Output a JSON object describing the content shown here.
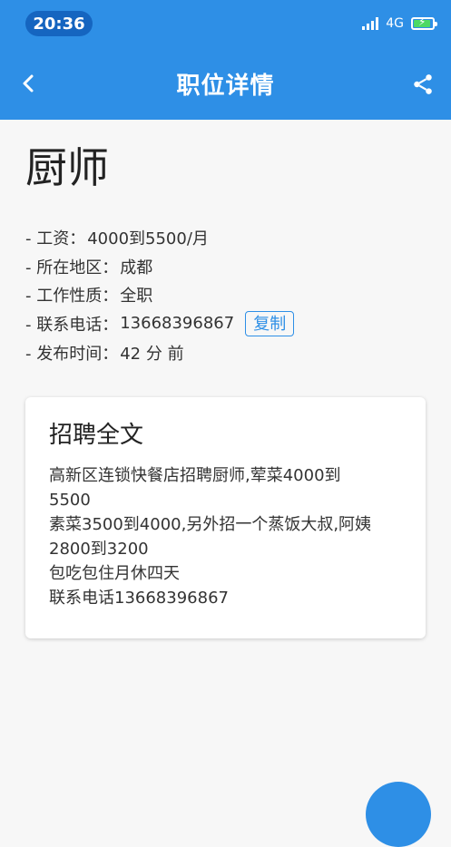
{
  "status": {
    "time": "20:36",
    "network": "4G"
  },
  "app_bar": {
    "title": "职位详情",
    "back_icon": "chevron-left-icon",
    "share_icon": "share-icon"
  },
  "job": {
    "title": "厨师",
    "details": [
      {
        "label": "- 工资：",
        "value": "4000到5500/月"
      },
      {
        "label": "- 所在地区：",
        "value": "成都"
      },
      {
        "label": "- 工作性质：",
        "value": "全职"
      },
      {
        "label": "- 联系电话：",
        "value": "13668396867"
      },
      {
        "label": "- 发布时间：",
        "value": "42 分 前"
      }
    ],
    "copy_label": "复制"
  },
  "card": {
    "title": "招聘全文",
    "lines": [
      "高新区连锁快餐店招聘厨师,荤菜4000到",
      "5500",
      "素菜3500到4000,另外招一个蒸饭大叔,阿姨",
      "2800到3200",
      "包吃包住月休四天",
      "联系电话13668396867"
    ]
  },
  "colors": {
    "primary": "#2e8fe6",
    "background": "#f7f7f7",
    "card": "#ffffff"
  }
}
